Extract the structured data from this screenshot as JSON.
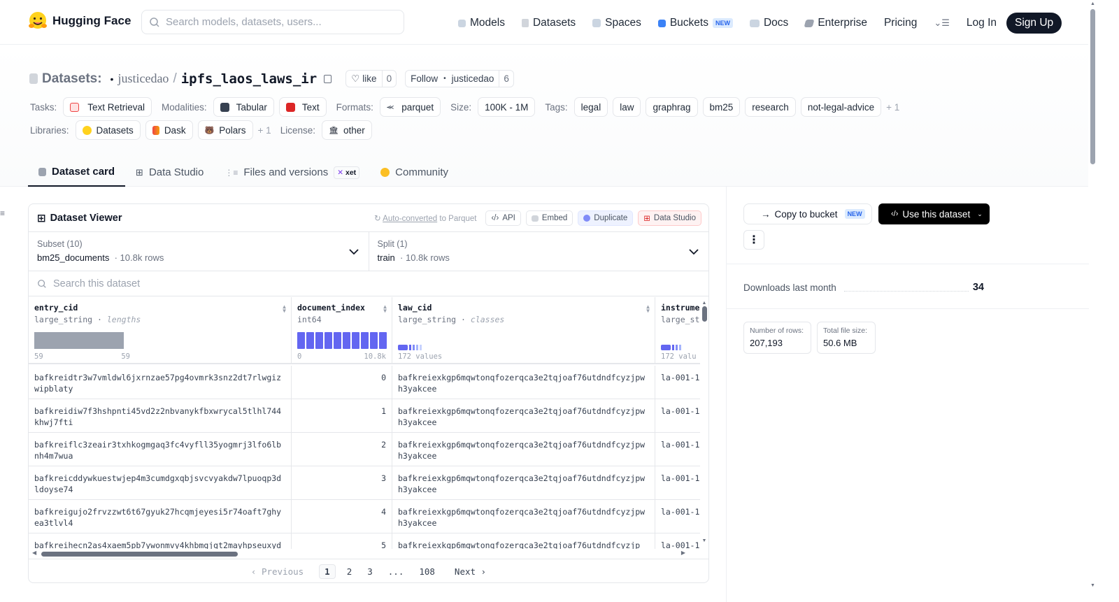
{
  "header": {
    "brand": "Hugging Face",
    "search_placeholder": "Search models, datasets, users...",
    "nav": {
      "models": "Models",
      "datasets": "Datasets",
      "spaces": "Spaces",
      "buckets": "Buckets",
      "buckets_badge": "NEW",
      "docs": "Docs",
      "enterprise": "Enterprise",
      "pricing": "Pricing"
    },
    "login": "Log In",
    "signup": "Sign Up"
  },
  "repo": {
    "prefix": "Datasets:",
    "owner": "justicedao",
    "name": "ipfs_laos_laws_ir",
    "like_label": "like",
    "like_count": "0",
    "follow_label": "Follow",
    "follow_owner": "justicedao",
    "follow_count": "6"
  },
  "meta": {
    "tasks_label": "Tasks:",
    "task": "Text Retrieval",
    "modalities_label": "Modalities:",
    "modality_1": "Tabular",
    "modality_2": "Text",
    "formats_label": "Formats:",
    "format": "parquet",
    "size_label": "Size:",
    "size": "100K - 1M",
    "tags_label": "Tags:",
    "tags": [
      "legal",
      "law",
      "graphrag",
      "bm25",
      "research",
      "not-legal-advice"
    ],
    "tags_more": "+ 1",
    "libraries_label": "Libraries:",
    "libraries": [
      "Datasets",
      "Dask",
      "Polars"
    ],
    "libraries_more": "+ 1",
    "license_label": "License:",
    "license": "other"
  },
  "tabs": {
    "card": "Dataset card",
    "studio": "Data Studio",
    "files": "Files and versions",
    "xet": "xet",
    "community": "Community"
  },
  "viewer": {
    "title": "Dataset Viewer",
    "auto_converted": "Auto-converted",
    "to_parquet": "to Parquet",
    "api": "API",
    "embed": "Embed",
    "duplicate": "Duplicate",
    "data_studio": "Data Studio",
    "subset_label": "Subset (10)",
    "subset_value": "bm25_documents",
    "subset_rows": "10.8k rows",
    "split_label": "Split (1)",
    "split_value": "train",
    "split_rows": "10.8k rows",
    "search_placeholder": "Search this dataset",
    "columns": [
      {
        "name": "entry_cid",
        "type": "large_string",
        "kind": "lengths",
        "min": "59",
        "max": "59"
      },
      {
        "name": "document_index",
        "type": "int64",
        "kind": "",
        "min": "0",
        "max": "10.8k"
      },
      {
        "name": "law_cid",
        "type": "large_string",
        "kind": "classes",
        "values": "172 values"
      },
      {
        "name": "instrume",
        "type": "large_st",
        "kind": "",
        "values": "172 valu"
      }
    ],
    "rows": [
      {
        "entry": "bafkreidtr3w7vmldwl6jxrnzae57pg4ovmrk3snz2dt7rlwgizwipblaty",
        "idx": "0",
        "law": "bafkreiexkgp6mqwtonqfozerqca3e2tqjoaf76utdndfcyzjpwh3yakcee",
        "inst": "la-001-1"
      },
      {
        "entry": "bafkreidiw7f3hshpnti45vd2z2nbvanykfbxwrycal5tlhl744khwj7fti",
        "idx": "1",
        "law": "bafkreiexkgp6mqwtonqfozerqca3e2tqjoaf76utdndfcyzjpwh3yakcee",
        "inst": "la-001-1"
      },
      {
        "entry": "bafkreiflc3zeair3txhkogmgaq3fc4vyfll35yogmrj3lfo6lbnh4m7wua",
        "idx": "2",
        "law": "bafkreiexkgp6mqwtonqfozerqca3e2tqjoaf76utdndfcyzjpwh3yakcee",
        "inst": "la-001-1"
      },
      {
        "entry": "bafkreicddywkuestwjep4m3cumdgxqbjsvcvyakdw7lpuoqp3dldoyse74",
        "idx": "3",
        "law": "bafkreiexkgp6mqwtonqfozerqca3e2tqjoaf76utdndfcyzjpwh3yakcee",
        "inst": "la-001-1"
      },
      {
        "entry": "bafkreigujo2frvzzwt6t67gyuk27hcqmjeyesi5r74oaft7ghyea3tlvl4",
        "idx": "4",
        "law": "bafkreiexkgp6mqwtonqfozerqca3e2tqjoaf76utdndfcyzjpwh3yakcee",
        "inst": "la-001-1"
      },
      {
        "entry": "bafkreihecn2as4xaem5pb7ywonmvy4khbmgjgt2mayhpseuxyd",
        "idx": "5",
        "law": "bafkreiexkgp6mqwtonqfozerqca3e2tqjoaf76utdndfcyzjp",
        "inst": "la-001-1"
      }
    ],
    "pager": {
      "prev": "Previous",
      "p1": "1",
      "p2": "2",
      "p3": "3",
      "dots": "...",
      "last": "108",
      "next": "Next"
    }
  },
  "sidebar": {
    "copy": "Copy to bucket",
    "copy_badge": "NEW",
    "use": "Use this dataset",
    "downloads_label": "Downloads last month",
    "downloads_value": "34",
    "rows_label": "Number of rows:",
    "rows_value": "207,193",
    "size_label": "Total file size:",
    "size_value": "50.6 MB"
  },
  "colors": {
    "accent": "#6366f1",
    "dark": "#111827",
    "histogram_gray": "#9ca3af"
  }
}
